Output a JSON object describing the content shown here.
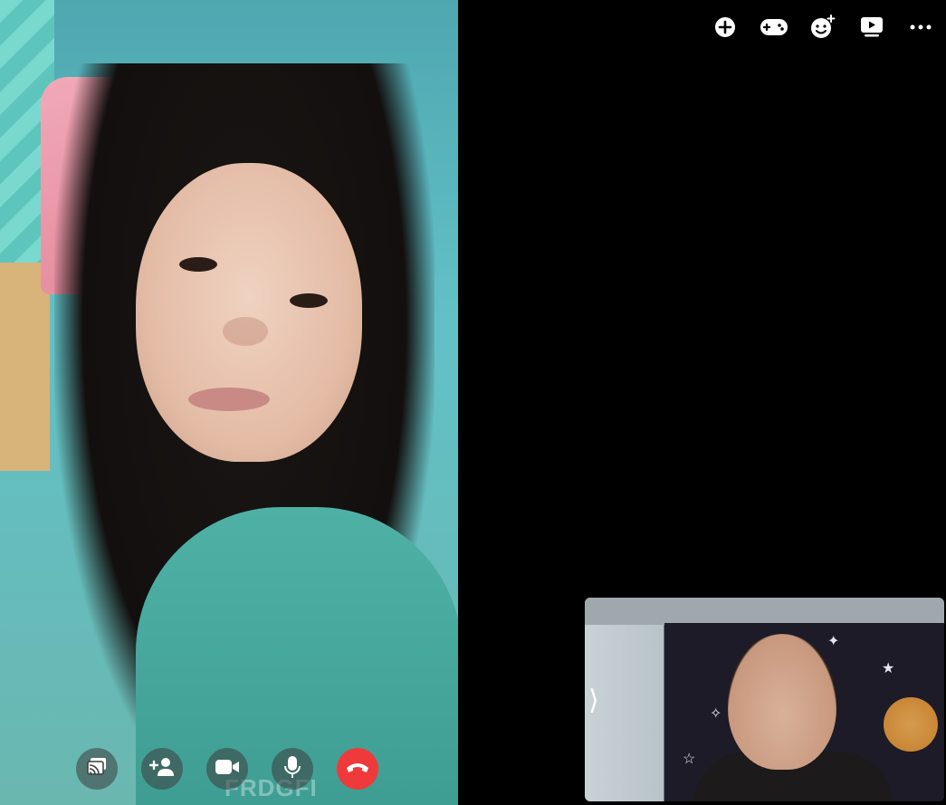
{
  "remote": {
    "shirt_text": "FRDGFI"
  },
  "toolbar": {
    "buttons": [
      {
        "icon": "add-circle-icon"
      },
      {
        "icon": "game-controller-icon"
      },
      {
        "icon": "add-effect-icon"
      },
      {
        "icon": "watch-together-icon"
      },
      {
        "icon": "more-options-icon"
      }
    ]
  },
  "controls": {
    "buttons": [
      {
        "icon": "share-screen-icon"
      },
      {
        "icon": "add-person-icon"
      },
      {
        "icon": "camera-icon"
      },
      {
        "icon": "microphone-icon"
      },
      {
        "icon": "end-call-icon",
        "color": "#ee3a3a"
      }
    ]
  },
  "self_view": {
    "expand_glyph": "⟩"
  }
}
